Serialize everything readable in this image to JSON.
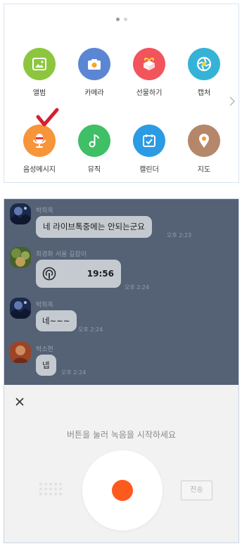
{
  "attach_menu": {
    "items": [
      {
        "label": "앨범",
        "color": "#8cc63f"
      },
      {
        "label": "카메라",
        "color": "#5b86d4"
      },
      {
        "label": "선물하기",
        "color": "#f2545b"
      },
      {
        "label": "캡처",
        "color": "#35b3d6"
      },
      {
        "label": "음성메시지",
        "color": "#f7953a"
      },
      {
        "label": "뮤직",
        "color": "#3fbf66"
      },
      {
        "label": "캘린더",
        "color": "#2b9be3"
      },
      {
        "label": "지도",
        "color": "#b5876a"
      }
    ],
    "page_count": 2,
    "current_page": 1
  },
  "chat": {
    "messages": [
      {
        "sender": "박희옥",
        "text": "네 라이브톡중에는 안되는군요",
        "time": "오후 2:23"
      },
      {
        "sender": "최경화 서울 길잡이",
        "voice_duration": "19:56",
        "time": "오후 2:24"
      },
      {
        "sender": "박희옥",
        "text": "네~~~",
        "time": "오후 2:24"
      },
      {
        "sender": "박소현",
        "text": "넵",
        "time": "오후 2:24"
      }
    ]
  },
  "recorder": {
    "hint": "버튼을 눌러 녹음을 시작하세요",
    "send_label": "전송",
    "record_color": "#ff5a1e"
  }
}
